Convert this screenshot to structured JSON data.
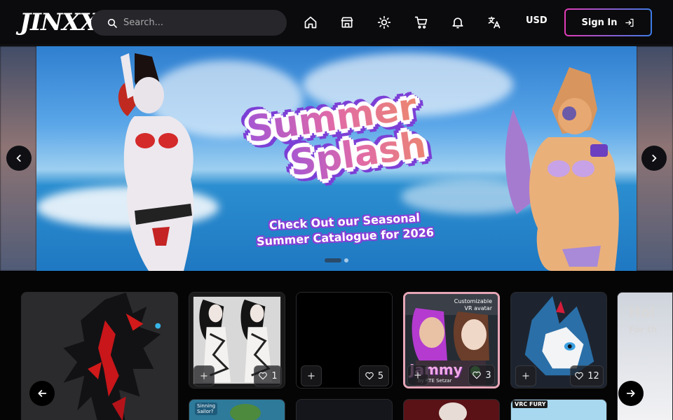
{
  "brand": {
    "logo_text": "JINXXY"
  },
  "search": {
    "placeholder": "Search..."
  },
  "nav": {
    "icons": [
      "home-icon",
      "store-icon",
      "sun-icon",
      "cart-icon",
      "bell-icon",
      "translate-icon"
    ],
    "currency": "USD",
    "signin_label": "Sign In"
  },
  "hero": {
    "title_line1": "Summer",
    "title_line2": "Splash",
    "subtitle_line1": "Check Out our Seasonal",
    "subtitle_line2": "Summer Catalogue for 2026",
    "slides_total": 2,
    "active_slide": 1
  },
  "products": {
    "cards": [
      {
        "likes": "1"
      },
      {
        "likes": "5"
      },
      {
        "likes": "3",
        "overlay_top": "Customizable",
        "overlay_top2": "VR avatar",
        "overlay_name": "Jammy",
        "overlay_by": "by RTE Setzar"
      },
      {
        "likes": "12"
      }
    ],
    "partial_card_text": "Hol",
    "partial_card_sub": "For th",
    "row2_tags": [
      "Sinning Sailor?",
      "VRC FURY"
    ]
  },
  "colors": {
    "accent_pink": "#e23bb6",
    "accent_blue": "#3d7be6",
    "bg": "#000000",
    "header_bg": "#0b0b0d"
  }
}
